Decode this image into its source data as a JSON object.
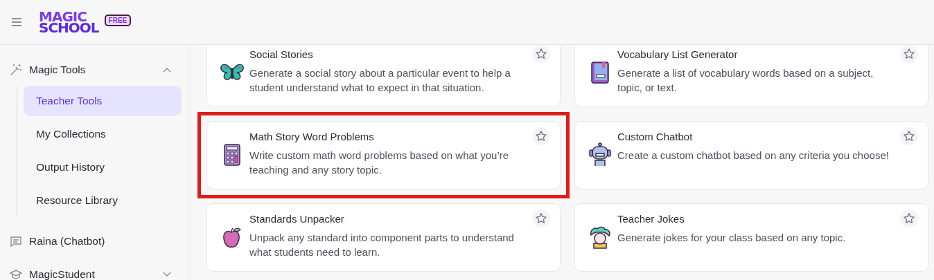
{
  "header": {
    "logo_top": "MAGIC",
    "logo_bottom": "SCHOOL",
    "badge": "FREE"
  },
  "sidebar": {
    "items": [
      {
        "label": "Magic Tools",
        "expanded": true,
        "children": [
          {
            "label": "Teacher Tools",
            "selected": true
          },
          {
            "label": "My Collections",
            "selected": false
          },
          {
            "label": "Output History",
            "selected": false
          },
          {
            "label": "Resource Library",
            "selected": false
          }
        ]
      },
      {
        "label": "Raina (Chatbot)"
      },
      {
        "label": "MagicStudent",
        "expanded": false
      }
    ]
  },
  "tools": [
    {
      "title": "Social Stories",
      "description": "Generate a social story about a particular event to help a student understand what to expect in that situation.",
      "highlighted": false
    },
    {
      "title": "Vocabulary List Generator",
      "description": "Generate a list of vocabulary words based on a subject, topic, or text.",
      "highlighted": false
    },
    {
      "title": "Math Story Word Problems",
      "description": "Write custom math word problems based on what you’re teaching and any story topic.",
      "highlighted": true
    },
    {
      "title": "Custom Chatbot",
      "description": "Create a custom chatbot based on any criteria you choose!",
      "highlighted": false
    },
    {
      "title": "Standards Unpacker",
      "description": "Unpack any standard into component parts to understand what students need to learn.",
      "highlighted": false
    },
    {
      "title": "Teacher Jokes",
      "description": "Generate jokes for your class based on any topic.",
      "highlighted": false
    }
  ]
}
